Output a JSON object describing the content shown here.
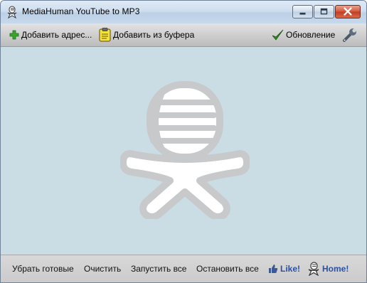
{
  "window": {
    "title": "MediaHuman YouTube to MP3"
  },
  "toolbar": {
    "add_url_label": "Добавить адрес...",
    "add_clipboard_label": "Добавить из буфера",
    "update_label": "Обновление"
  },
  "statusbar": {
    "remove_done_label": "Убрать готовые",
    "clear_label": "Очистить",
    "start_all_label": "Запустить все",
    "stop_all_label": "Остановить все",
    "like_label": "Like!",
    "home_label": "Home!"
  },
  "colors": {
    "content_bg": "#cadde5",
    "link": "#2c4fa0",
    "close_button": "#c23c1e"
  },
  "icons": {
    "app": "mediahuman-logo-icon",
    "add": "green-plus-icon",
    "clipboard": "clipboard-icon",
    "update": "green-check-icon",
    "settings": "wrench-icon",
    "like": "thumbs-up-icon",
    "home": "mediahuman-logo-icon"
  }
}
